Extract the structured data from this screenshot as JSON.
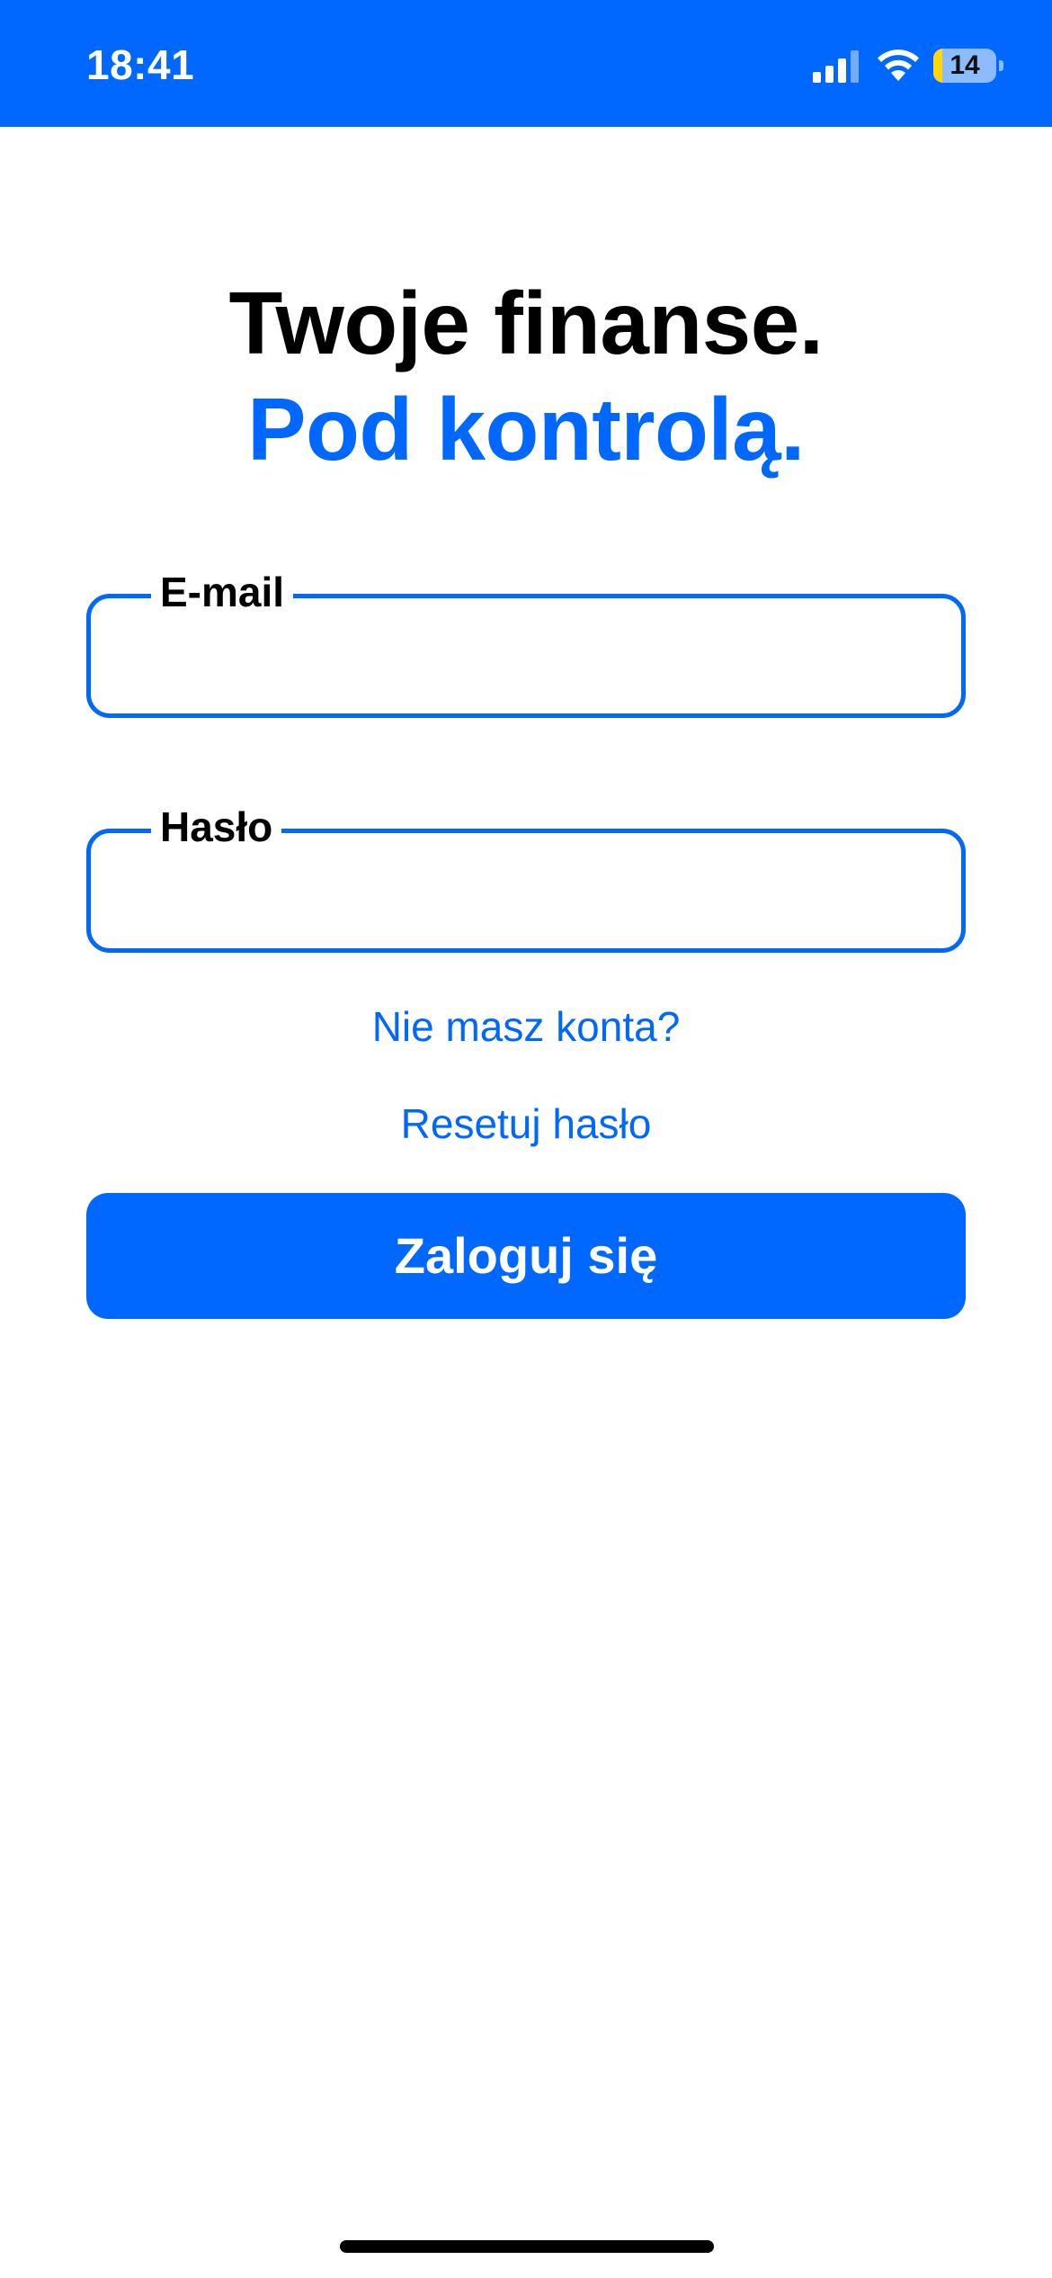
{
  "status_bar": {
    "time": "18:41",
    "battery_level": "14",
    "battery_fraction": 0.14,
    "background_color": "#0068ff",
    "battery_color": "#ffd60a",
    "icons": [
      "signal-icon",
      "wifi-icon",
      "battery-icon"
    ]
  },
  "headline": {
    "line1": "Twoje finanse.",
    "line2": "Pod kontrolą."
  },
  "form": {
    "email": {
      "label": "E-mail",
      "value": "",
      "placeholder": ""
    },
    "password": {
      "label": "Hasło",
      "value": "",
      "placeholder": ""
    }
  },
  "links": {
    "no_account": "Nie masz konta?",
    "reset_password": "Resetuj hasło"
  },
  "button": {
    "login_label": "Zaloguj się"
  },
  "theme": {
    "accent": "#0068ff",
    "text": "#000000",
    "background": "#ffffff"
  }
}
